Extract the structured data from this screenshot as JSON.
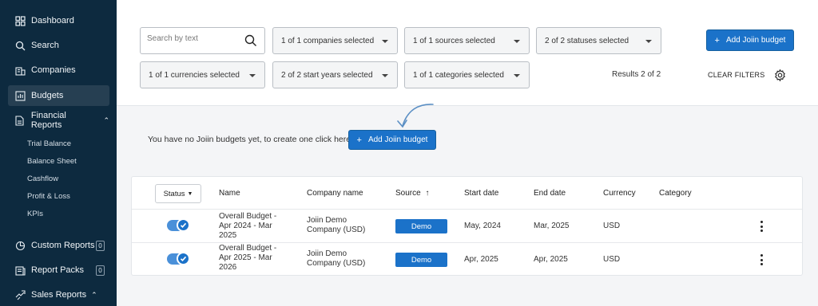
{
  "sidebar": {
    "items": [
      {
        "label": "Dashboard",
        "icon": "grid-icon"
      },
      {
        "label": "Search",
        "icon": "search-icon"
      },
      {
        "label": "Companies",
        "icon": "building-icon"
      },
      {
        "label": "Budgets",
        "icon": "bar-chart-icon",
        "active": true
      },
      {
        "label": "Financial Reports",
        "icon": "document-icon",
        "expanded": true
      },
      {
        "label": "Custom Reports",
        "icon": "pie-chart-icon",
        "count": "0"
      },
      {
        "label": "Report Packs",
        "icon": "folder-icon",
        "count": "0"
      },
      {
        "label": "Sales Reports",
        "icon": "handshake-icon",
        "expanded": true
      }
    ],
    "financial_sub_items": [
      "Trial Balance",
      "Balance Sheet",
      "Cashflow",
      "Profit & Loss",
      "KPIs"
    ]
  },
  "filters": {
    "search_placeholder": "Search by text",
    "companies": "1 of 1 companies selected",
    "sources": "1 of 1 sources selected",
    "statuses": "2 of 2 statuses selected",
    "currencies": "1 of 1 currencies selected",
    "start_years": "2 of 2 start years selected",
    "categories": "1 of 1 categories selected",
    "add_button": "Add Joiin budget",
    "results": "Results 2 of 2",
    "clear": "CLEAR FILTERS"
  },
  "empty_state": {
    "text": "You have no Joiin budgets yet, to create one click here",
    "button": "Add Joiin budget"
  },
  "table": {
    "status_label": "Status",
    "headers": {
      "name": "Name",
      "company": "Company name",
      "source": "Source",
      "start": "Start date",
      "end": "End date",
      "currency": "Currency",
      "category": "Category"
    },
    "rows": [
      {
        "name_lines": [
          "Overall Budget -",
          "Apr 2024 - Mar",
          "2025"
        ],
        "company_lines": [
          "Joiin Demo",
          "Company (USD)"
        ],
        "source": "Demo",
        "start": "May, 2024",
        "end": "Mar, 2025",
        "currency": "USD",
        "category": "",
        "enabled": true
      },
      {
        "name_lines": [
          "Overall Budget -",
          "Apr 2025 - Mar",
          "2026"
        ],
        "company_lines": [
          "Joiin Demo",
          "Company (USD)"
        ],
        "source": "Demo",
        "start": "Apr, 2025",
        "end": "Apr, 2025",
        "currency": "USD",
        "category": "",
        "enabled": true
      }
    ]
  },
  "colors": {
    "sidebar_bg": "#0d2a3f",
    "accent": "#1b72c9"
  }
}
